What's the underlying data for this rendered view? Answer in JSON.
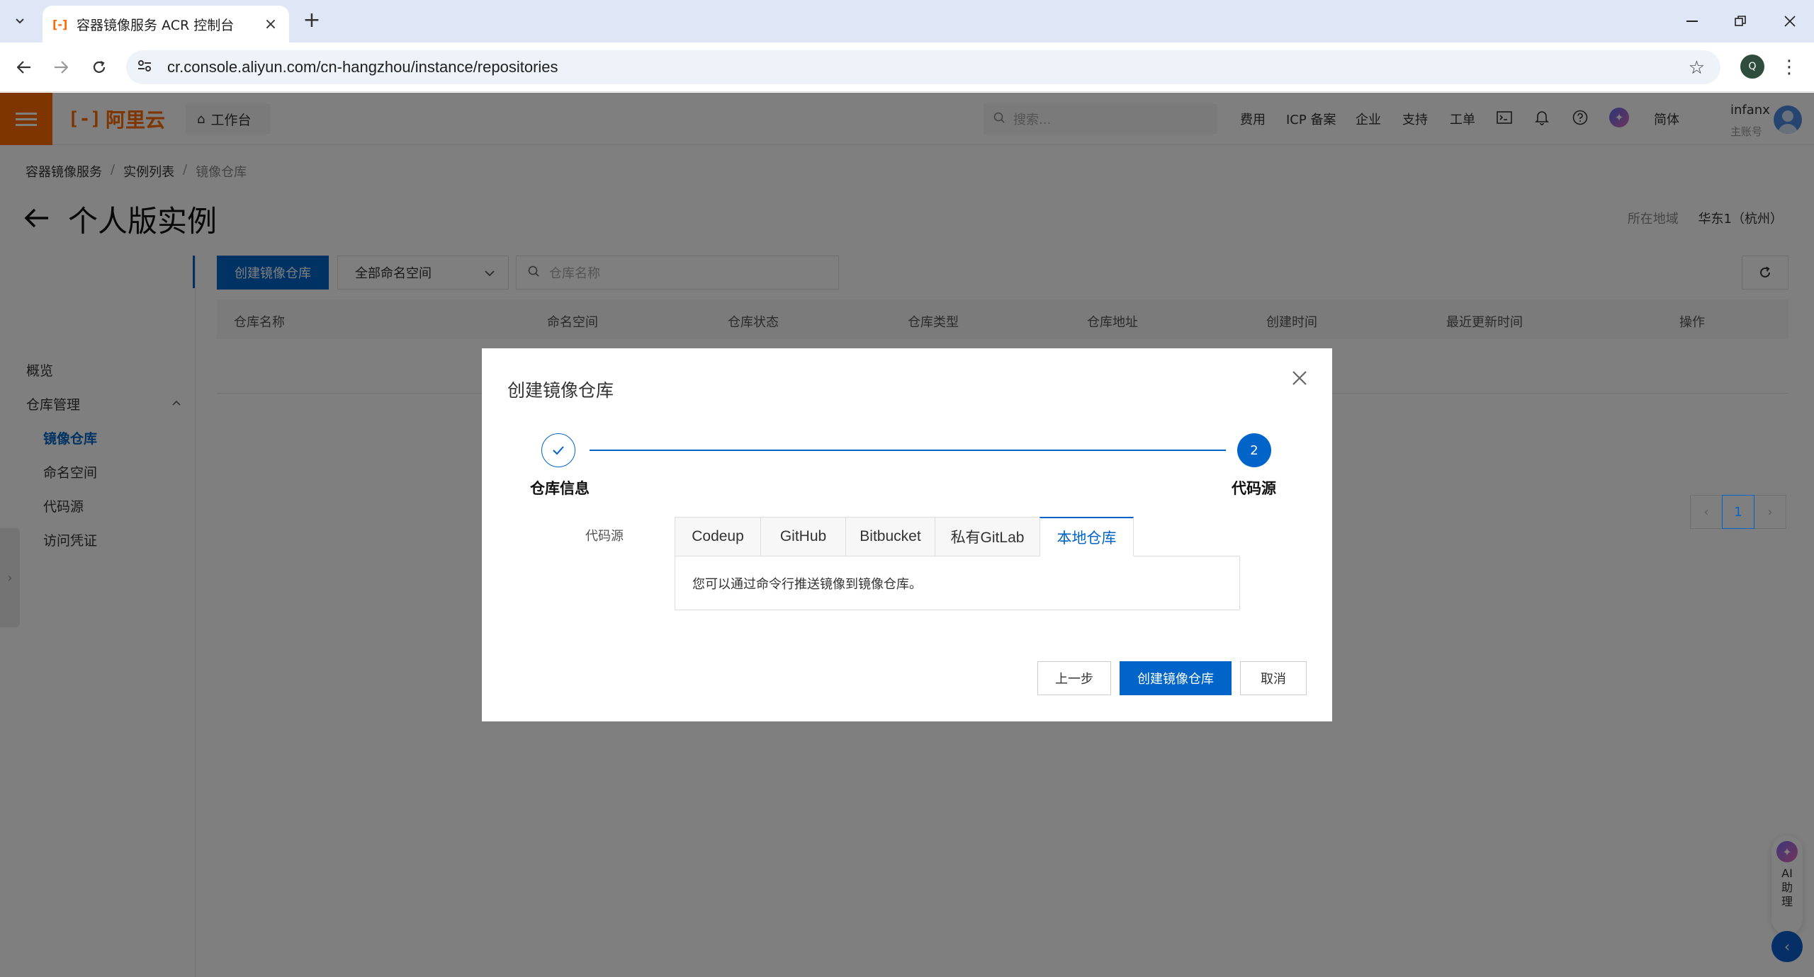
{
  "browser": {
    "tab_title": "容器镜像服务 ACR 控制台",
    "url": "cr.console.aliyun.com/cn-hangzhou/instance/repositories",
    "profile_initial": "Q"
  },
  "topnav": {
    "logo_text": "阿里云",
    "workbench": "工作台",
    "search_placeholder": "搜索...",
    "items": [
      "费用",
      "ICP 备案",
      "企业",
      "支持",
      "工单"
    ],
    "language": "简体",
    "user_name": "infanx",
    "user_role": "主账号"
  },
  "breadcrumb": [
    "容器镜像服务",
    "实例列表",
    "镜像仓库"
  ],
  "page": {
    "title": "个人版实例",
    "region_label": "所在地域",
    "region_value": "华东1（杭州）"
  },
  "sidenav": {
    "overview": "概览",
    "repo_mgmt": "仓库管理",
    "items": [
      "镜像仓库",
      "命名空间",
      "代码源",
      "访问凭证"
    ]
  },
  "toolbar": {
    "create_button": "创建镜像仓库",
    "namespace_select": "全部命名空间",
    "search_placeholder": "仓库名称"
  },
  "table": {
    "columns": [
      "仓库名称",
      "命名空间",
      "仓库状态",
      "仓库类型",
      "仓库地址",
      "创建时间",
      "最近更新时间",
      "操作"
    ]
  },
  "pagination": {
    "current_page": "1"
  },
  "ai_assistant": {
    "label": "AI助理"
  },
  "modal": {
    "title": "创建镜像仓库",
    "steps": [
      {
        "label": "仓库信息",
        "status": "done"
      },
      {
        "label": "代码源",
        "number": "2",
        "status": "current"
      }
    ],
    "source_label": "代码源",
    "source_tabs": [
      "Codeup",
      "GitHub",
      "Bitbucket",
      "私有GitLab",
      "本地仓库"
    ],
    "active_tab": "本地仓库",
    "panel_text": "您可以通过命令行推送镜像到镜像仓库。",
    "buttons": {
      "prev": "上一步",
      "create": "创建镜像仓库",
      "cancel": "取消"
    }
  },
  "colors": {
    "brand": "#ff6a00",
    "primary": "#0064c8"
  }
}
